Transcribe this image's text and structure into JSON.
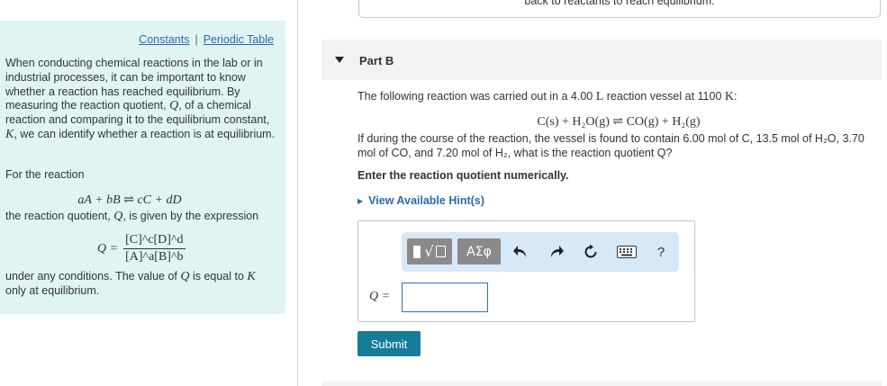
{
  "links": {
    "constants": "Constants",
    "separator": "|",
    "periodic_table": "Periodic Table"
  },
  "left": {
    "intro_1": "When conducting chemical reactions in the lab or in industrial processes, it can be important to know whether a reaction has reached equilibrium. By measuring the reaction quotient, ",
    "intro_q": "Q",
    "intro_2": ", of a chemical reaction and comparing it to the equilibrium constant, ",
    "intro_k": "K",
    "intro_3": ", we can identify whether a reaction is at equilibrium.",
    "for_reaction": "For the reaction",
    "general_eq": "aA + bB ⇌ cC + dD",
    "given_1": "the reaction quotient, ",
    "given_q": "Q",
    "given_2": ", is given by the expression",
    "q_lhs": "Q =",
    "q_num": "[C]^c[D]^d",
    "q_den": "[A]^a[B]^b",
    "under_1": "under any conditions. The value of ",
    "under_q": "Q",
    "under_2": " is equal to ",
    "under_k": "K",
    "under_3": " only at equilibrium."
  },
  "previous_part": {
    "text": "back to reactants to reach equilibrium."
  },
  "part_b": {
    "title": "Part B",
    "statement_1": "The following reaction was carried out in a 4.00 ",
    "statement_unit": "L",
    "statement_2": " reaction vessel at 1100 ",
    "statement_temp": "K",
    "statement_3": ":",
    "reaction": "C(s) + H₂O(g) ⇌ CO(g) + H₂(g)",
    "question": "If during the course of the reaction, the vessel is found to contain 6.00 mol of C, 13.5 mol of H₂O, 3.70 mol of CO, and 7.20 mol of H₂, what is the reaction quotient Q?",
    "enter_label": "Enter the reaction quotient numerically.",
    "hints": "View Available Hint(s)"
  },
  "toolbar": {
    "greek_label": "ΑΣφ",
    "help_label": "?",
    "icons": [
      "template-icon",
      "undo-icon",
      "redo-icon",
      "reset-icon",
      "keyboard-icon",
      "help-icon"
    ]
  },
  "answer": {
    "label": "Q =",
    "value": ""
  },
  "submit": {
    "label": "Submit"
  },
  "colors": {
    "left_panel": "#e0f4f4",
    "link": "#2a6aa8",
    "submit": "#147d9a",
    "toolbar": "#d7e8f6",
    "input_border": "#2a73b8"
  }
}
